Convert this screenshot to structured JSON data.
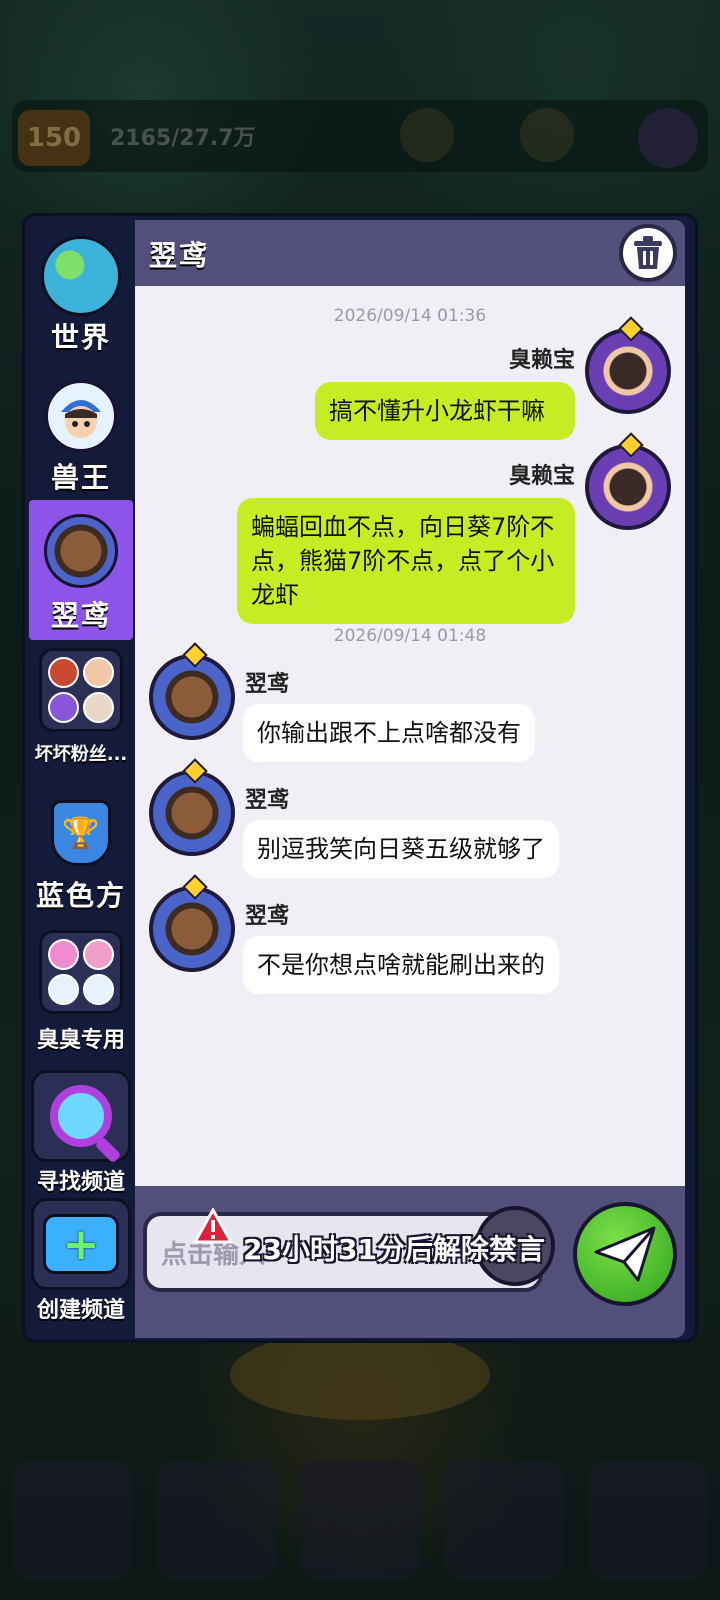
{
  "background": {
    "level": "150",
    "energy": "2165/27.7万"
  },
  "sidebar": {
    "items": [
      {
        "label": "世界"
      },
      {
        "label": "兽王"
      },
      {
        "label": "翌鸢"
      },
      {
        "label": "坏坏粉丝..."
      },
      {
        "label": "蓝色方"
      },
      {
        "label": "臭臭专用"
      }
    ],
    "find_channel_label": "寻找频道",
    "create_channel_label": "创建频道"
  },
  "chat": {
    "title": "翌鸢",
    "messages": [
      {
        "type": "time",
        "text": "2026/09/14 01:36"
      },
      {
        "type": "out",
        "sender": "臭赖宝",
        "text": "搞不懂升小龙虾干嘛"
      },
      {
        "type": "out",
        "sender": "臭赖宝",
        "text": "蝙蝠回血不点，向日葵7阶不点，熊猫7阶不点，点了个小龙虾"
      },
      {
        "type": "time",
        "text": "2026/09/14 01:48"
      },
      {
        "type": "in",
        "sender": "翌鸢",
        "text": "你输出跟不上点啥都没有"
      },
      {
        "type": "in",
        "sender": "翌鸢",
        "text": "别逗我笑向日葵五级就够了"
      },
      {
        "type": "in",
        "sender": "翌鸢",
        "text": "不是你想点啥就能刷出来的"
      }
    ],
    "input_placeholder": "点击输入",
    "mute_notice": "23小时31分后解除禁言"
  },
  "colors": {
    "active_tab": "#8c54e8",
    "outgoing_bubble": "#c6ec23",
    "incoming_bubble": "#ffffff",
    "header": "#524f7a",
    "send_button": "#2fa31c"
  }
}
